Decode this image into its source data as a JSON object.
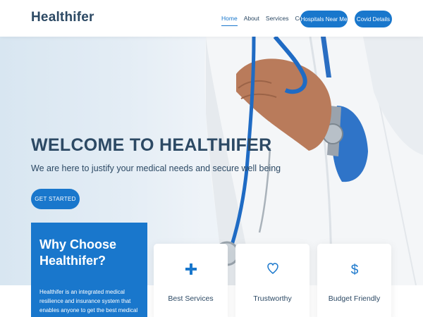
{
  "header": {
    "logo": "Healthifer",
    "nav": [
      "Home",
      "About",
      "Services",
      "Contact"
    ],
    "active_nav": "Home",
    "hospitals_button": "Hospitals Near Me",
    "covid_button": "Covid Details"
  },
  "hero": {
    "title": "WELCOME TO HEALTHIFER",
    "subtitle": "We are here to justify your medical needs and secure well being",
    "cta": "GET STARTED"
  },
  "why": {
    "title": "Why Choose Healthifer?",
    "text": "Healthifer is an integrated medical resilience and insurance system that enables anyone to get the best medical assistance within a"
  },
  "cards": [
    {
      "title": "Best Services",
      "icon": "plus-icon"
    },
    {
      "title": "Trustworthy",
      "icon": "heart-icon"
    },
    {
      "title": "Budget Friendly",
      "icon": "dollar-icon"
    }
  ],
  "colors": {
    "accent": "#1977cc",
    "text": "#2c4964"
  }
}
